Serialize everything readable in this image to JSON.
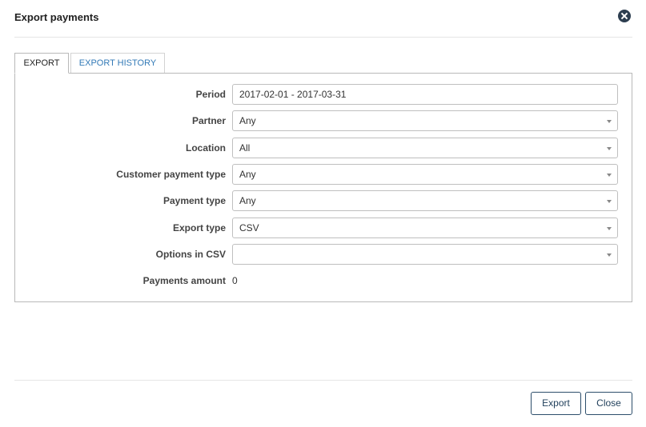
{
  "dialog": {
    "title": "Export payments"
  },
  "tabs": [
    {
      "label": "EXPORT",
      "active": true
    },
    {
      "label": "EXPORT HISTORY",
      "active": false
    }
  ],
  "form": {
    "period": {
      "label": "Period",
      "value": "2017-02-01 - 2017-03-31"
    },
    "partner": {
      "label": "Partner",
      "value": "Any"
    },
    "location": {
      "label": "Location",
      "value": "All"
    },
    "customer_payment_type": {
      "label": "Customer payment type",
      "value": "Any"
    },
    "payment_type": {
      "label": "Payment type",
      "value": "Any"
    },
    "export_type": {
      "label": "Export type",
      "value": "CSV"
    },
    "options_in_csv": {
      "label": "Options in CSV",
      "value": ""
    },
    "payments_amount": {
      "label": "Payments amount",
      "value": "0"
    }
  },
  "footer": {
    "export_label": "Export",
    "close_label": "Close"
  },
  "colors": {
    "accent": "#337ab7",
    "button_border": "#2d4e6b",
    "close_icon": "#2d3e50"
  },
  "icons": {
    "close": "close-circle-icon",
    "select": "caret-down-icon"
  }
}
